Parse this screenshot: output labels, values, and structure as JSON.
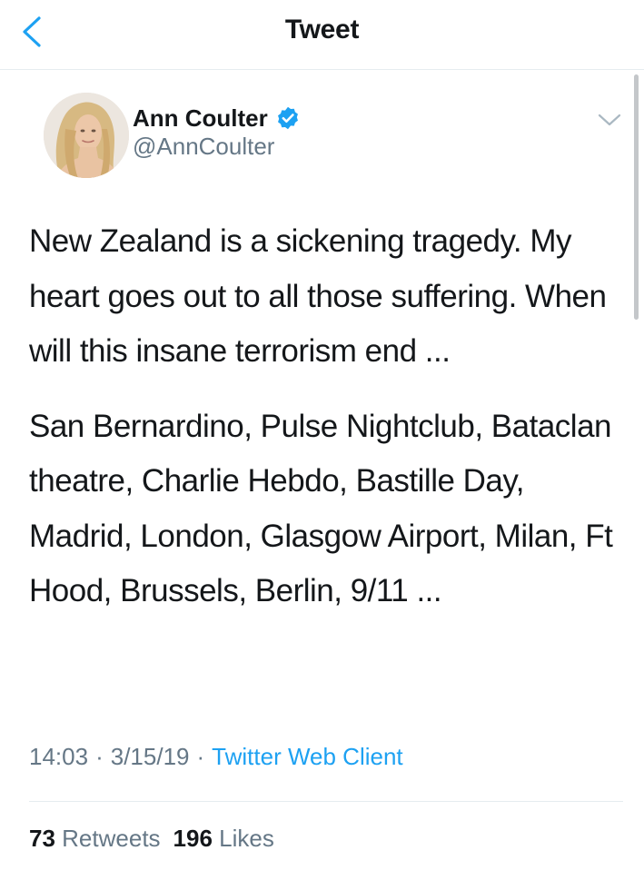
{
  "header": {
    "title": "Tweet",
    "back_icon": "chevron-left-icon"
  },
  "author": {
    "name": "Ann Coulter",
    "handle": "@AnnCoulter",
    "verified_icon": "verified-badge-icon",
    "menu_icon": "chevron-down-icon"
  },
  "tweet": {
    "paragraphs": [
      "New Zealand is a sickening tragedy. My heart goes out to all those suffering. When will this insane terrorism end ...",
      "San Bernardino, Pulse Nightclub, Bataclan theatre, Charlie Hebdo, Bastille Day, Madrid, London, Glasgow Airport, Milan, Ft Hood, Brussels, Berlin, 9/11 ..."
    ],
    "time": "14:03",
    "date": "3/15/19",
    "separator": "·",
    "client": "Twitter Web Client"
  },
  "stats": {
    "retweets_count": "73",
    "retweets_label": "Retweets",
    "likes_count": "196",
    "likes_label": "Likes"
  },
  "colors": {
    "accent": "#1da1f2",
    "text": "#14171a",
    "muted": "#657786",
    "divider": "#e6ecf0"
  }
}
